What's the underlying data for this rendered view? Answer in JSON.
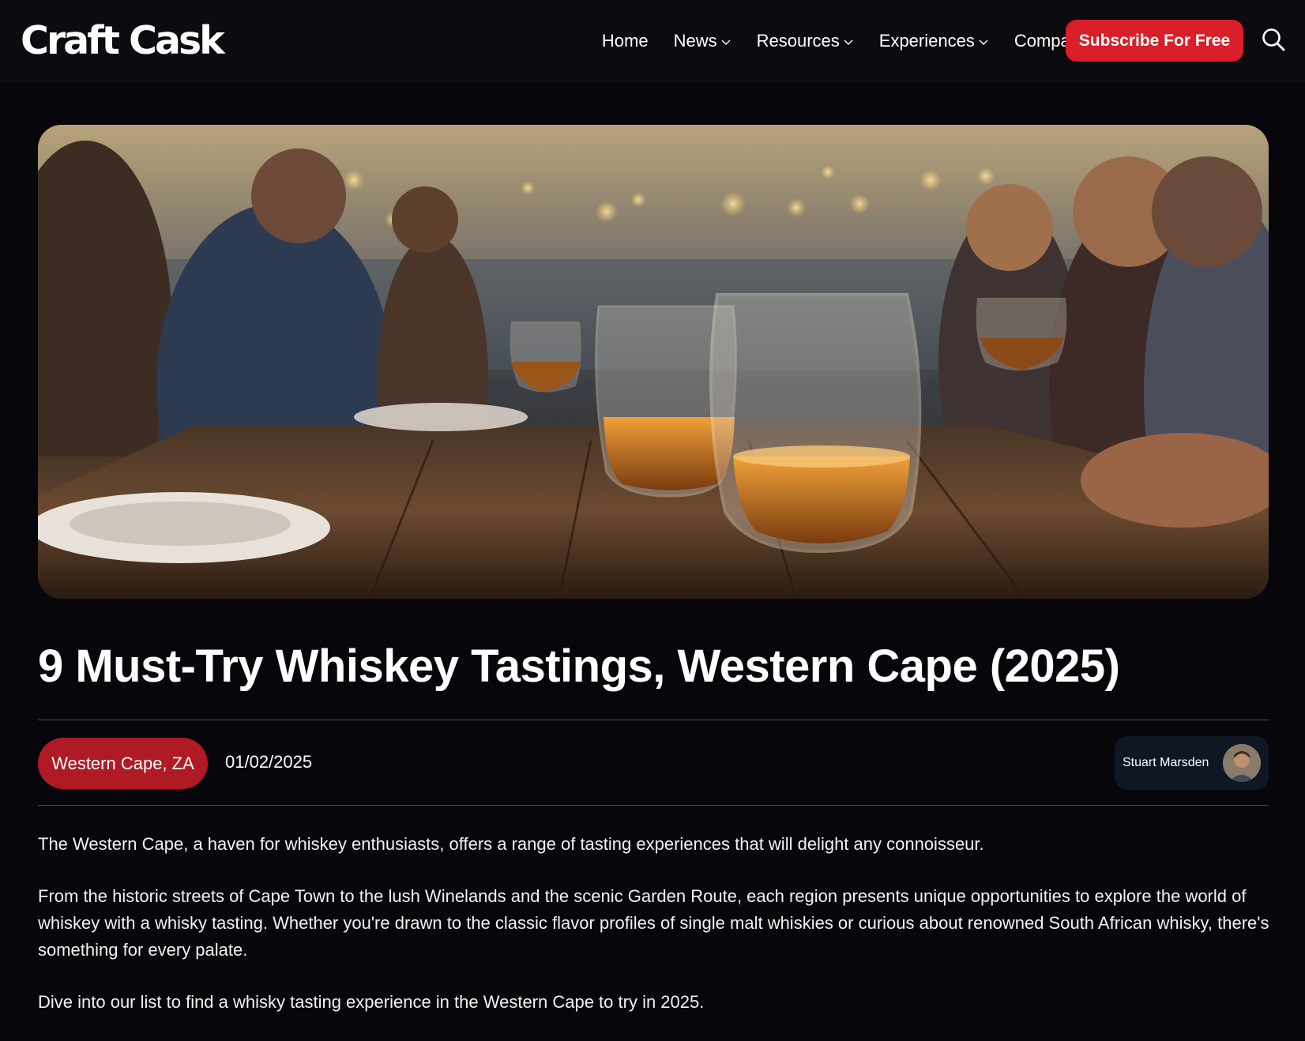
{
  "header": {
    "logo": "Craft Cask",
    "nav": [
      {
        "label": "Home",
        "dropdown": false
      },
      {
        "label": "News",
        "dropdown": true
      },
      {
        "label": "Resources",
        "dropdown": true
      },
      {
        "label": "Experiences",
        "dropdown": true
      },
      {
        "label": "Company",
        "dropdown": true
      }
    ],
    "subscribe_label": "Subscribe For Free",
    "search_icon": "search-icon"
  },
  "article": {
    "hero_image": "whiskey-tasting-hero-image",
    "title": "9 Must-Try Whiskey Tastings, Western Cape (2025)",
    "tag": "Western Cape, ZA",
    "date": "01/02/2025",
    "author": "Stuart Marsden",
    "paragraphs": [
      "The Western Cape, a haven for whiskey enthusiasts, offers a range of tasting experiences that will delight any connoisseur.",
      "From the historic streets of Cape Town to the lush Winelands and the scenic Garden Route, each region presents unique opportunities to explore the world of whiskey with a whisky tasting. Whether you're drawn to the classic flavor profiles of single malt whiskies or curious about renowned South African whisky, there's something for every palate.",
      "Dive into our list to find a whisky tasting experience in the Western Cape to try in 2025."
    ]
  },
  "colors": {
    "background": "#07070b",
    "navbar": "#0c0c10",
    "accent": "#d81f2a",
    "tag": "#b01a24",
    "author_card": "#0f1624"
  }
}
